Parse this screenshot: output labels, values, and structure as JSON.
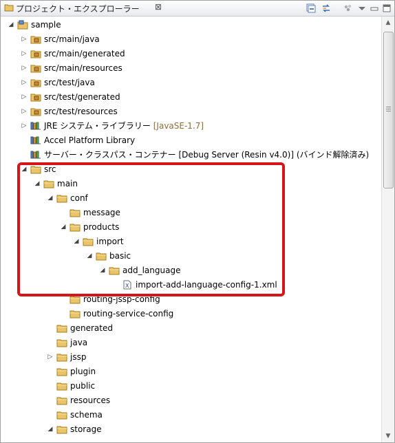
{
  "panel": {
    "title": "プロジェクト・エクスプローラー",
    "close_glyph": "⊠"
  },
  "colors": {
    "highlight": "#d6151b",
    "folder": "#e9c46a",
    "decoration": "#8a6d3b"
  },
  "tree": [
    {
      "depth": 0,
      "twisty": "expanded",
      "icon": "project-icon",
      "label": "sample"
    },
    {
      "depth": 1,
      "twisty": "collapsed",
      "icon": "package-folder-icon",
      "label": "src/main/java"
    },
    {
      "depth": 1,
      "twisty": "collapsed",
      "icon": "package-folder-icon",
      "label": "src/main/generated"
    },
    {
      "depth": 1,
      "twisty": "collapsed",
      "icon": "package-folder-icon",
      "label": "src/main/resources"
    },
    {
      "depth": 1,
      "twisty": "collapsed",
      "icon": "package-folder-icon",
      "label": "src/test/java"
    },
    {
      "depth": 1,
      "twisty": "collapsed",
      "icon": "package-folder-icon",
      "label": "src/test/generated"
    },
    {
      "depth": 1,
      "twisty": "collapsed",
      "icon": "package-folder-icon",
      "label": "src/test/resources"
    },
    {
      "depth": 1,
      "twisty": "collapsed",
      "icon": "library-icon",
      "label": "JRE システム・ライブラリー",
      "decoration": "[JavaSE-1.7]"
    },
    {
      "depth": 1,
      "twisty": "none",
      "icon": "library-icon",
      "label": "Accel Platform Library"
    },
    {
      "depth": 1,
      "twisty": "none",
      "icon": "library-icon",
      "label": "サーバー・クラスパス・コンテナー [Debug Server (Resin v4.0)] (バインド解除済み)"
    },
    {
      "depth": 1,
      "twisty": "expanded",
      "icon": "folder-icon",
      "label": "src"
    },
    {
      "depth": 2,
      "twisty": "expanded",
      "icon": "folder-icon",
      "label": "main"
    },
    {
      "depth": 3,
      "twisty": "expanded",
      "icon": "folder-icon",
      "label": "conf"
    },
    {
      "depth": 4,
      "twisty": "none",
      "icon": "folder-icon",
      "label": "message"
    },
    {
      "depth": 4,
      "twisty": "expanded",
      "icon": "folder-icon",
      "label": "products"
    },
    {
      "depth": 5,
      "twisty": "expanded",
      "icon": "folder-icon",
      "label": "import"
    },
    {
      "depth": 6,
      "twisty": "expanded",
      "icon": "folder-icon",
      "label": "basic"
    },
    {
      "depth": 7,
      "twisty": "expanded",
      "icon": "folder-icon",
      "label": "add_language"
    },
    {
      "depth": 8,
      "twisty": "none",
      "icon": "xml-file-icon",
      "label": "import-add-language-config-1.xml"
    },
    {
      "depth": 4,
      "twisty": "none",
      "icon": "folder-icon",
      "label": "routing-jssp-config"
    },
    {
      "depth": 4,
      "twisty": "none",
      "icon": "folder-icon",
      "label": "routing-service-config"
    },
    {
      "depth": 3,
      "twisty": "none",
      "icon": "folder-icon",
      "label": "generated"
    },
    {
      "depth": 3,
      "twisty": "none",
      "icon": "folder-icon",
      "label": "java"
    },
    {
      "depth": 3,
      "twisty": "collapsed",
      "icon": "folder-icon",
      "label": "jssp"
    },
    {
      "depth": 3,
      "twisty": "none",
      "icon": "folder-icon",
      "label": "plugin"
    },
    {
      "depth": 3,
      "twisty": "none",
      "icon": "folder-icon",
      "label": "public"
    },
    {
      "depth": 3,
      "twisty": "none",
      "icon": "folder-icon",
      "label": "resources"
    },
    {
      "depth": 3,
      "twisty": "none",
      "icon": "folder-icon",
      "label": "schema"
    },
    {
      "depth": 3,
      "twisty": "expanded",
      "icon": "folder-icon",
      "label": "storage"
    }
  ]
}
